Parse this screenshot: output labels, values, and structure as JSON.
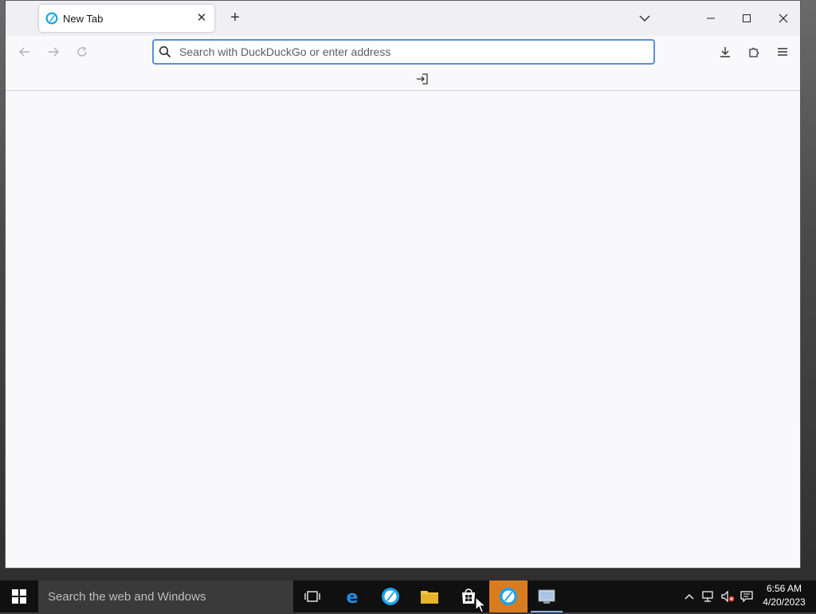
{
  "browser": {
    "tab": {
      "title": "New Tab",
      "close_glyph": "✕"
    },
    "new_tab_glyph": "+",
    "urlbar": {
      "placeholder": "Search with DuckDuckGo or enter address",
      "value": ""
    },
    "icons": {
      "back": "arrow-left-icon",
      "forward": "arrow-right-icon",
      "reload": "reload-icon",
      "search": "search-icon",
      "downloads": "download-icon",
      "extensions": "puzzle-icon",
      "menu": "hamburger-menu-icon",
      "import": "import-bookmarks-icon"
    },
    "colors": {
      "accent": "#5b8fd6",
      "chrome": "#f0f0f4",
      "content": "#f9f9fb"
    }
  },
  "taskbar": {
    "search_placeholder": "Search the web and Windows",
    "clock": {
      "time": "6:56 AM",
      "date": "4/20/2023"
    },
    "apps": [
      "task-view-icon",
      "edge-icon",
      "browser-icon",
      "file-explorer-icon",
      "store-icon",
      "browser-active-icon",
      "control-panel-icon"
    ],
    "active_color": "#d97b1f"
  }
}
